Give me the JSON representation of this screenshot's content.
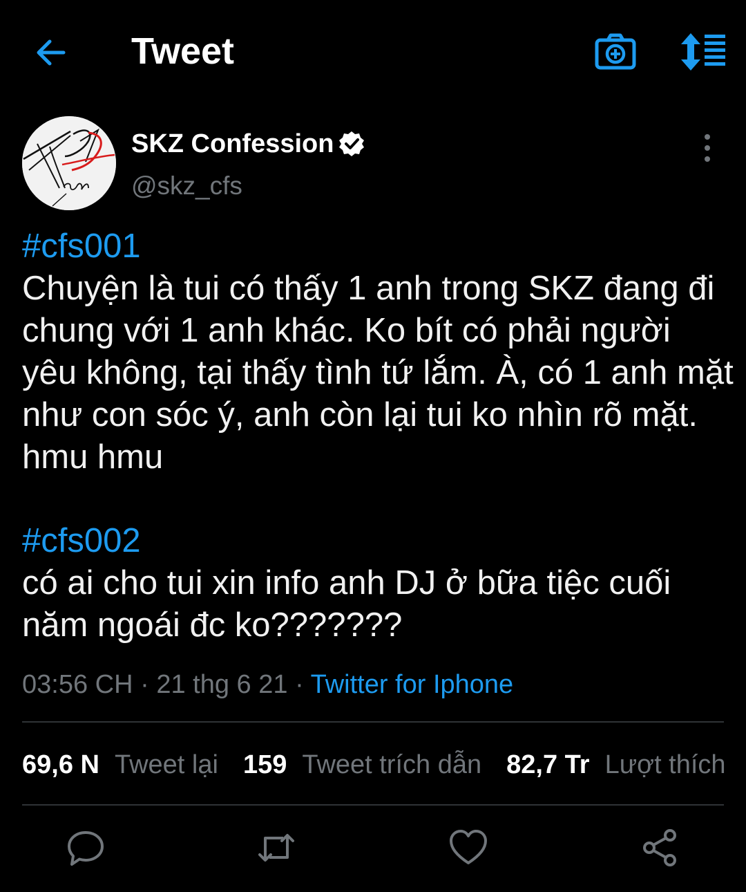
{
  "header": {
    "title": "Tweet",
    "back_icon": "arrow-left-icon",
    "camera_icon": "camera-add-icon",
    "sort_icon": "sort-list-icon"
  },
  "author": {
    "name": "SKZ Confession",
    "handle": "@skz_cfs",
    "verified": true,
    "avatar_icon": "signature-logo"
  },
  "tweet": {
    "hashtag1": "#cfs001",
    "text1": "Chuyện là tui có thấy 1 anh trong SKZ đang đi chung với 1 anh khác. Ko bít có phải người yêu không, tại thấy tình tứ lắm. À, có 1 anh mặt như con sóc ý, anh còn lại tui ko nhìn rõ mặt. hmu hmu",
    "hashtag2": "#cfs002",
    "text2": "có ai cho tui xin info anh DJ ở bữa tiệc cuối năm ngoái đc ko???????"
  },
  "meta": {
    "time": "03:56 CH",
    "date": "21 thg 6 21",
    "separator": "·",
    "source": "Twitter for Iphone"
  },
  "stats": {
    "retweets_count": "69,6 N",
    "retweets_label": "Tweet lại",
    "quotes_count": "159",
    "quotes_label": "Tweet trích dẫn",
    "likes_count": "82,7 Tr",
    "likes_label": "Lượt thích"
  },
  "actions": {
    "reply_icon": "reply-icon",
    "retweet_icon": "retweet-icon",
    "like_icon": "heart-icon",
    "share_icon": "share-icon"
  },
  "colors": {
    "background": "#000000",
    "accent": "#1d9bf0",
    "muted": "#71767b",
    "text": "#e7e9ea",
    "divider": "#2f3336"
  }
}
